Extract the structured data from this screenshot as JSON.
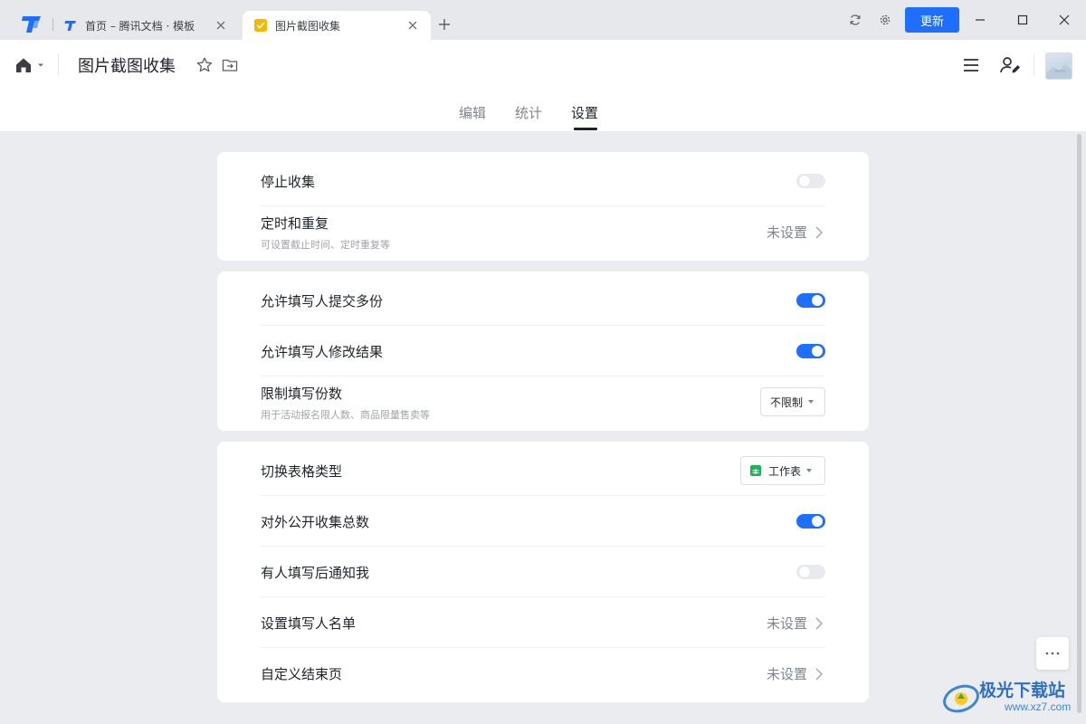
{
  "titlebar": {
    "tabs": [
      {
        "label": "首页 – 腾讯文档 · 模板",
        "active": false
      },
      {
        "label": "图片截图收集",
        "active": true
      }
    ],
    "update_label": "更新",
    "accent_color": "#1e6fff"
  },
  "header": {
    "doc_title": "图片截图收集",
    "subtabs": [
      {
        "label": "编辑",
        "active": false
      },
      {
        "label": "统计",
        "active": false
      },
      {
        "label": "设置",
        "active": true
      }
    ]
  },
  "settings": {
    "card1": {
      "stop_collect": {
        "title": "停止收集",
        "enabled": false
      },
      "schedule": {
        "title": "定时和重复",
        "subtitle": "可设置截止时间、定时重复等",
        "value": "未设置"
      }
    },
    "card2": {
      "multi_submit": {
        "title": "允许填写人提交多份",
        "enabled": true
      },
      "modify_result": {
        "title": "允许填写人修改结果",
        "enabled": true
      },
      "limit_count": {
        "title": "限制填写份数",
        "subtitle": "用于活动报名限人数、商品限量售卖等",
        "value": "不限制"
      }
    },
    "card3": {
      "table_type": {
        "title": "切换表格类型",
        "value": "工作表"
      },
      "public_total": {
        "title": "对外公开收集总数",
        "enabled": true
      },
      "notify_me": {
        "title": "有人填写后通知我",
        "enabled": false
      },
      "fillers_list": {
        "title": "设置填写人名单",
        "value": "未设置"
      },
      "end_page": {
        "title": "自定义结束页",
        "value": "未设置"
      }
    }
  },
  "watermark": {
    "text": "极光下载站",
    "url": "www.xz7.com"
  }
}
